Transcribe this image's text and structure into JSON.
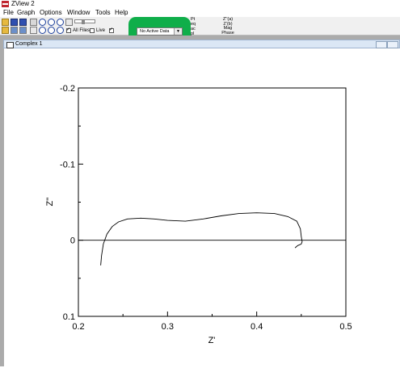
{
  "app": {
    "title": "ZView 2"
  },
  "menu": [
    "File",
    "Graph",
    "Options",
    "Window",
    "Tools",
    "Help"
  ],
  "toolbar": {
    "all_files_label": "All Files",
    "live_label": "Live",
    "active_data": "No Active Data",
    "info_labels": [
      "Pt",
      "eq",
      "ac",
      "pl"
    ],
    "info_values": [
      "Z''(a)",
      "Z'(b)",
      "Mag",
      "Phase"
    ],
    "highlight_color": "#0fae4a"
  },
  "graph_window": {
    "title": "Complex 1"
  },
  "chart_data": {
    "type": "line",
    "xlabel": "Z'",
    "ylabel": "Z''",
    "xlim": [
      0.2,
      0.5
    ],
    "ylim": [
      0.1,
      -0.2
    ],
    "y_inverted": true,
    "x_ticks": [
      "0.2",
      "0.3",
      "0.4",
      "0.5"
    ],
    "y_ticks": [
      "-0.2",
      "-0.1",
      "0",
      "0.1"
    ],
    "series": [
      {
        "x": [
          0.225,
          0.226,
          0.228,
          0.232,
          0.238,
          0.245,
          0.255,
          0.27,
          0.285,
          0.3,
          0.32,
          0.34,
          0.36,
          0.38,
          0.4,
          0.42,
          0.435,
          0.445,
          0.449,
          0.45,
          0.451,
          0.45,
          0.446,
          0.443
        ],
        "y": [
          0.033,
          0.02,
          0.005,
          -0.008,
          -0.018,
          -0.024,
          -0.028,
          -0.029,
          -0.028,
          -0.026,
          -0.025,
          -0.028,
          -0.032,
          -0.035,
          -0.036,
          -0.035,
          -0.031,
          -0.025,
          -0.015,
          -0.005,
          0.002,
          0.005,
          0.007,
          0.01
        ]
      }
    ]
  }
}
